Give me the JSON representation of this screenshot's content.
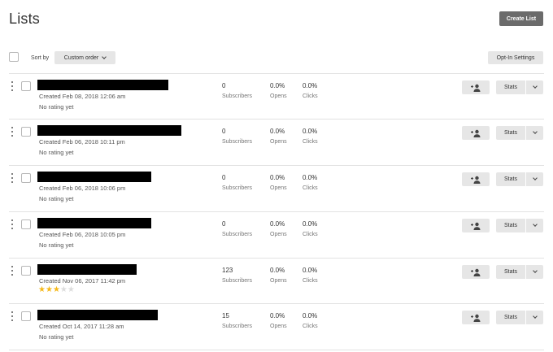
{
  "header": {
    "title": "Lists",
    "create_label": "Create List"
  },
  "toolbar": {
    "sort_label": "Sort by",
    "sort_value": "Custom order",
    "optin_label": "Opt-In Settings"
  },
  "stat_labels": {
    "subscribers": "Subscribers",
    "opens": "Opens",
    "clicks": "Clicks"
  },
  "row_buttons": {
    "stats_label": "Stats",
    "add_icon": "add-subscriber-icon",
    "dropdown_icon": "chevron-down-icon"
  },
  "colors": {
    "star_on": "#f5b81a",
    "star_off": "#dcdcdc",
    "primary_button": "#6b6b6b"
  },
  "lists": [
    {
      "created": "Created Feb 08, 2018 12:06 am",
      "rating_text": "No rating yet",
      "rating": null,
      "subscribers": "0",
      "opens": "0.0%",
      "clicks": "0.0%"
    },
    {
      "created": "Created Feb 06, 2018 10:11 pm",
      "rating_text": "No rating yet",
      "rating": null,
      "subscribers": "0",
      "opens": "0.0%",
      "clicks": "0.0%"
    },
    {
      "created": "Created Feb 06, 2018 10:06 pm",
      "rating_text": "No rating yet",
      "rating": null,
      "subscribers": "0",
      "opens": "0.0%",
      "clicks": "0.0%"
    },
    {
      "created": "Created Feb 06, 2018 10:05 pm",
      "rating_text": "No rating yet",
      "rating": null,
      "subscribers": "0",
      "opens": "0.0%",
      "clicks": "0.0%"
    },
    {
      "created": "Created Nov 06, 2017 11:42 pm",
      "rating_text": "",
      "rating": 3,
      "subscribers": "123",
      "opens": "0.0%",
      "clicks": "0.0%"
    },
    {
      "created": "Created Oct 14, 2017 11:28 am",
      "rating_text": "No rating yet",
      "rating": null,
      "subscribers": "15",
      "opens": "0.0%",
      "clicks": "0.0%"
    }
  ]
}
